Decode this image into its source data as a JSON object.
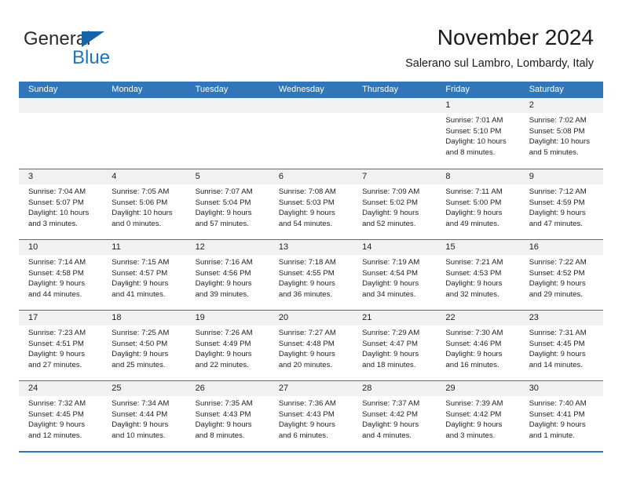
{
  "brand": {
    "name_part1": "General",
    "name_part2": "Blue",
    "triangle_color": "#1565a8",
    "blue_text_color": "#1c74bd"
  },
  "header": {
    "title": "November 2024",
    "location": "Salerano sul Lambro, Lombardy, Italy"
  },
  "theme": {
    "header_blue": "#3176b9",
    "day_head_gray": "#f1f1f1",
    "text_color": "#222222"
  },
  "weekdays": [
    "Sunday",
    "Monday",
    "Tuesday",
    "Wednesday",
    "Thursday",
    "Friday",
    "Saturday"
  ],
  "weeks": [
    [
      {
        "day": "",
        "lines": []
      },
      {
        "day": "",
        "lines": []
      },
      {
        "day": "",
        "lines": []
      },
      {
        "day": "",
        "lines": []
      },
      {
        "day": "",
        "lines": []
      },
      {
        "day": "1",
        "lines": [
          "Sunrise: 7:01 AM",
          "Sunset: 5:10 PM",
          "Daylight: 10 hours",
          "and 8 minutes."
        ]
      },
      {
        "day": "2",
        "lines": [
          "Sunrise: 7:02 AM",
          "Sunset: 5:08 PM",
          "Daylight: 10 hours",
          "and 5 minutes."
        ]
      }
    ],
    [
      {
        "day": "3",
        "lines": [
          "Sunrise: 7:04 AM",
          "Sunset: 5:07 PM",
          "Daylight: 10 hours",
          "and 3 minutes."
        ]
      },
      {
        "day": "4",
        "lines": [
          "Sunrise: 7:05 AM",
          "Sunset: 5:06 PM",
          "Daylight: 10 hours",
          "and 0 minutes."
        ]
      },
      {
        "day": "5",
        "lines": [
          "Sunrise: 7:07 AM",
          "Sunset: 5:04 PM",
          "Daylight: 9 hours",
          "and 57 minutes."
        ]
      },
      {
        "day": "6",
        "lines": [
          "Sunrise: 7:08 AM",
          "Sunset: 5:03 PM",
          "Daylight: 9 hours",
          "and 54 minutes."
        ]
      },
      {
        "day": "7",
        "lines": [
          "Sunrise: 7:09 AM",
          "Sunset: 5:02 PM",
          "Daylight: 9 hours",
          "and 52 minutes."
        ]
      },
      {
        "day": "8",
        "lines": [
          "Sunrise: 7:11 AM",
          "Sunset: 5:00 PM",
          "Daylight: 9 hours",
          "and 49 minutes."
        ]
      },
      {
        "day": "9",
        "lines": [
          "Sunrise: 7:12 AM",
          "Sunset: 4:59 PM",
          "Daylight: 9 hours",
          "and 47 minutes."
        ]
      }
    ],
    [
      {
        "day": "10",
        "lines": [
          "Sunrise: 7:14 AM",
          "Sunset: 4:58 PM",
          "Daylight: 9 hours",
          "and 44 minutes."
        ]
      },
      {
        "day": "11",
        "lines": [
          "Sunrise: 7:15 AM",
          "Sunset: 4:57 PM",
          "Daylight: 9 hours",
          "and 41 minutes."
        ]
      },
      {
        "day": "12",
        "lines": [
          "Sunrise: 7:16 AM",
          "Sunset: 4:56 PM",
          "Daylight: 9 hours",
          "and 39 minutes."
        ]
      },
      {
        "day": "13",
        "lines": [
          "Sunrise: 7:18 AM",
          "Sunset: 4:55 PM",
          "Daylight: 9 hours",
          "and 36 minutes."
        ]
      },
      {
        "day": "14",
        "lines": [
          "Sunrise: 7:19 AM",
          "Sunset: 4:54 PM",
          "Daylight: 9 hours",
          "and 34 minutes."
        ]
      },
      {
        "day": "15",
        "lines": [
          "Sunrise: 7:21 AM",
          "Sunset: 4:53 PM",
          "Daylight: 9 hours",
          "and 32 minutes."
        ]
      },
      {
        "day": "16",
        "lines": [
          "Sunrise: 7:22 AM",
          "Sunset: 4:52 PM",
          "Daylight: 9 hours",
          "and 29 minutes."
        ]
      }
    ],
    [
      {
        "day": "17",
        "lines": [
          "Sunrise: 7:23 AM",
          "Sunset: 4:51 PM",
          "Daylight: 9 hours",
          "and 27 minutes."
        ]
      },
      {
        "day": "18",
        "lines": [
          "Sunrise: 7:25 AM",
          "Sunset: 4:50 PM",
          "Daylight: 9 hours",
          "and 25 minutes."
        ]
      },
      {
        "day": "19",
        "lines": [
          "Sunrise: 7:26 AM",
          "Sunset: 4:49 PM",
          "Daylight: 9 hours",
          "and 22 minutes."
        ]
      },
      {
        "day": "20",
        "lines": [
          "Sunrise: 7:27 AM",
          "Sunset: 4:48 PM",
          "Daylight: 9 hours",
          "and 20 minutes."
        ]
      },
      {
        "day": "21",
        "lines": [
          "Sunrise: 7:29 AM",
          "Sunset: 4:47 PM",
          "Daylight: 9 hours",
          "and 18 minutes."
        ]
      },
      {
        "day": "22",
        "lines": [
          "Sunrise: 7:30 AM",
          "Sunset: 4:46 PM",
          "Daylight: 9 hours",
          "and 16 minutes."
        ]
      },
      {
        "day": "23",
        "lines": [
          "Sunrise: 7:31 AM",
          "Sunset: 4:45 PM",
          "Daylight: 9 hours",
          "and 14 minutes."
        ]
      }
    ],
    [
      {
        "day": "24",
        "lines": [
          "Sunrise: 7:32 AM",
          "Sunset: 4:45 PM",
          "Daylight: 9 hours",
          "and 12 minutes."
        ]
      },
      {
        "day": "25",
        "lines": [
          "Sunrise: 7:34 AM",
          "Sunset: 4:44 PM",
          "Daylight: 9 hours",
          "and 10 minutes."
        ]
      },
      {
        "day": "26",
        "lines": [
          "Sunrise: 7:35 AM",
          "Sunset: 4:43 PM",
          "Daylight: 9 hours",
          "and 8 minutes."
        ]
      },
      {
        "day": "27",
        "lines": [
          "Sunrise: 7:36 AM",
          "Sunset: 4:43 PM",
          "Daylight: 9 hours",
          "and 6 minutes."
        ]
      },
      {
        "day": "28",
        "lines": [
          "Sunrise: 7:37 AM",
          "Sunset: 4:42 PM",
          "Daylight: 9 hours",
          "and 4 minutes."
        ]
      },
      {
        "day": "29",
        "lines": [
          "Sunrise: 7:39 AM",
          "Sunset: 4:42 PM",
          "Daylight: 9 hours",
          "and 3 minutes."
        ]
      },
      {
        "day": "30",
        "lines": [
          "Sunrise: 7:40 AM",
          "Sunset: 4:41 PM",
          "Daylight: 9 hours",
          "and 1 minute."
        ]
      }
    ]
  ]
}
